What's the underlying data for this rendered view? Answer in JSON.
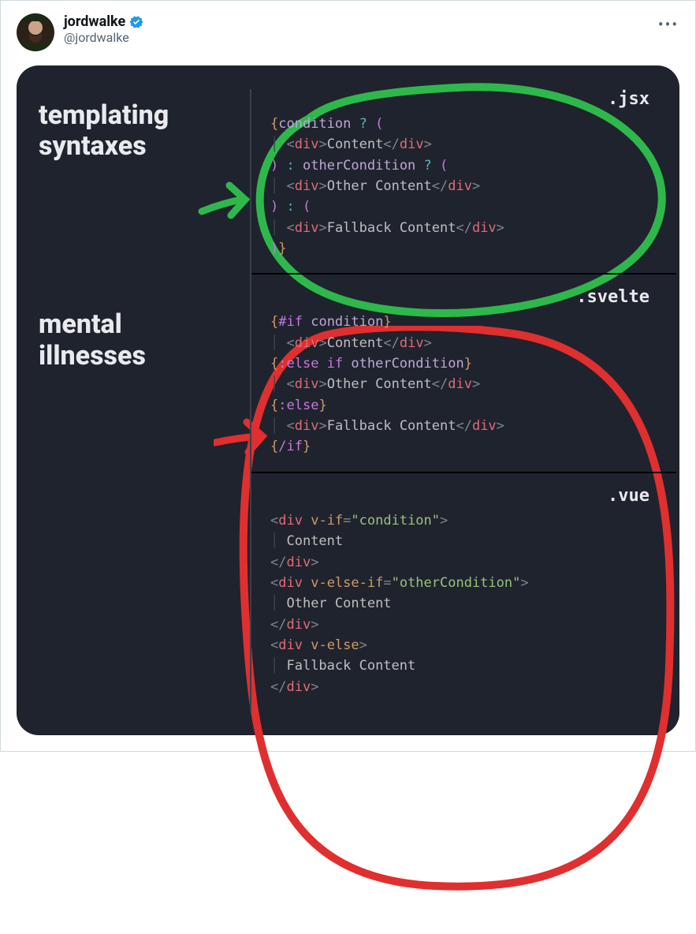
{
  "tweet": {
    "display_name": "jordwalke",
    "handle": "@jordwalke",
    "verified": true
  },
  "card": {
    "labels": {
      "top": "templating\nsyntaxes",
      "bottom": "mental\nillnesses"
    },
    "sections": {
      "jsx": {
        "lang": ".jsx",
        "lines": [
          [
            [
              "{",
              "c-brace-y"
            ],
            [
              "condition",
              "c-ident"
            ],
            [
              " ",
              "c-text"
            ],
            [
              "?",
              "c-op"
            ],
            [
              " ",
              "c-text"
            ],
            [
              "(",
              "c-paren"
            ]
          ],
          [
            [
              "│ ",
              "indent-guide"
            ],
            [
              "<",
              "c-angle"
            ],
            [
              "div",
              "c-tag"
            ],
            [
              ">",
              "c-angle"
            ],
            [
              "Content",
              "c-text"
            ],
            [
              "</",
              "c-angle"
            ],
            [
              "div",
              "c-tag"
            ],
            [
              ">",
              "c-angle"
            ]
          ],
          [
            [
              ")",
              "c-paren"
            ],
            [
              " ",
              "c-text"
            ],
            [
              ":",
              "c-op"
            ],
            [
              " ",
              "c-text"
            ],
            [
              "otherCondition",
              "c-ident"
            ],
            [
              " ",
              "c-text"
            ],
            [
              "?",
              "c-op"
            ],
            [
              " ",
              "c-text"
            ],
            [
              "(",
              "c-paren"
            ]
          ],
          [
            [
              "│ ",
              "indent-guide"
            ],
            [
              "<",
              "c-angle"
            ],
            [
              "div",
              "c-tag"
            ],
            [
              ">",
              "c-angle"
            ],
            [
              "Other Content",
              "c-text"
            ],
            [
              "</",
              "c-angle"
            ],
            [
              "div",
              "c-tag"
            ],
            [
              ">",
              "c-angle"
            ]
          ],
          [
            [
              ")",
              "c-paren"
            ],
            [
              " ",
              "c-text"
            ],
            [
              ":",
              "c-op"
            ],
            [
              " ",
              "c-text"
            ],
            [
              "(",
              "c-paren"
            ]
          ],
          [
            [
              "│ ",
              "indent-guide"
            ],
            [
              "<",
              "c-angle"
            ],
            [
              "div",
              "c-tag"
            ],
            [
              ">",
              "c-angle"
            ],
            [
              "Fallback Content",
              "c-text"
            ],
            [
              "</",
              "c-angle"
            ],
            [
              "div",
              "c-tag"
            ],
            [
              ">",
              "c-angle"
            ]
          ],
          [
            [
              ")",
              "c-paren"
            ],
            [
              "}",
              "c-brace-y"
            ]
          ]
        ]
      },
      "svelte": {
        "lang": ".svelte",
        "lines": [
          [
            [
              "{",
              "c-brace-y"
            ],
            [
              "#if",
              "c-key"
            ],
            [
              " ",
              "c-text"
            ],
            [
              "condition",
              "c-ident"
            ],
            [
              "}",
              "c-brace-y"
            ]
          ],
          [
            [
              "│ ",
              "indent-guide"
            ],
            [
              "<",
              "c-angle"
            ],
            [
              "div",
              "c-tag"
            ],
            [
              ">",
              "c-angle"
            ],
            [
              "Content",
              "c-text"
            ],
            [
              "</",
              "c-angle"
            ],
            [
              "div",
              "c-tag"
            ],
            [
              ">",
              "c-angle"
            ]
          ],
          [
            [
              "{",
              "c-brace-y"
            ],
            [
              ":else if",
              "c-key"
            ],
            [
              " ",
              "c-text"
            ],
            [
              "otherCondition",
              "c-ident"
            ],
            [
              "}",
              "c-brace-y"
            ]
          ],
          [
            [
              "│ ",
              "indent-guide"
            ],
            [
              "<",
              "c-angle"
            ],
            [
              "div",
              "c-tag"
            ],
            [
              ">",
              "c-angle"
            ],
            [
              "Other Content",
              "c-text"
            ],
            [
              "</",
              "c-angle"
            ],
            [
              "div",
              "c-tag"
            ],
            [
              ">",
              "c-angle"
            ]
          ],
          [
            [
              "{",
              "c-brace-y"
            ],
            [
              ":else",
              "c-key"
            ],
            [
              "}",
              "c-brace-y"
            ]
          ],
          [
            [
              "│ ",
              "indent-guide"
            ],
            [
              "<",
              "c-angle"
            ],
            [
              "div",
              "c-tag"
            ],
            [
              ">",
              "c-angle"
            ],
            [
              "Fallback Content",
              "c-text"
            ],
            [
              "</",
              "c-angle"
            ],
            [
              "div",
              "c-tag"
            ],
            [
              ">",
              "c-angle"
            ]
          ],
          [
            [
              "{",
              "c-brace-y"
            ],
            [
              "/if",
              "c-key"
            ],
            [
              "}",
              "c-brace-y"
            ]
          ]
        ]
      },
      "vue": {
        "lang": ".vue",
        "lines": [
          [
            [
              "<",
              "c-angle"
            ],
            [
              "div",
              "c-tag"
            ],
            [
              " ",
              "c-text"
            ],
            [
              "v-if",
              "c-attr"
            ],
            [
              "=",
              "c-angle"
            ],
            [
              "\"condition\"",
              "c-str"
            ],
            [
              ">",
              "c-angle"
            ]
          ],
          [
            [
              "│ ",
              "indent-guide"
            ],
            [
              "Content",
              "c-text"
            ]
          ],
          [
            [
              "</",
              "c-angle"
            ],
            [
              "div",
              "c-tag"
            ],
            [
              ">",
              "c-angle"
            ]
          ],
          [
            [
              "<",
              "c-angle"
            ],
            [
              "div",
              "c-tag"
            ],
            [
              " ",
              "c-text"
            ],
            [
              "v-else-if",
              "c-attr"
            ],
            [
              "=",
              "c-angle"
            ],
            [
              "\"otherCondition\"",
              "c-str"
            ],
            [
              ">",
              "c-angle"
            ]
          ],
          [
            [
              "│ ",
              "indent-guide"
            ],
            [
              "Other Content",
              "c-text"
            ]
          ],
          [
            [
              "</",
              "c-angle"
            ],
            [
              "div",
              "c-tag"
            ],
            [
              ">",
              "c-angle"
            ]
          ],
          [
            [
              "<",
              "c-angle"
            ],
            [
              "div",
              "c-tag"
            ],
            [
              " ",
              "c-text"
            ],
            [
              "v-else",
              "c-attr"
            ],
            [
              ">",
              "c-angle"
            ]
          ],
          [
            [
              "│ ",
              "indent-guide"
            ],
            [
              "Fallback Content",
              "c-text"
            ]
          ],
          [
            [
              "</",
              "c-angle"
            ],
            [
              "div",
              "c-tag"
            ],
            [
              ">",
              "c-angle"
            ]
          ]
        ]
      }
    },
    "annotations": {
      "green_circle_color": "#2eb84b",
      "red_circle_color": "#e02f2f"
    }
  }
}
